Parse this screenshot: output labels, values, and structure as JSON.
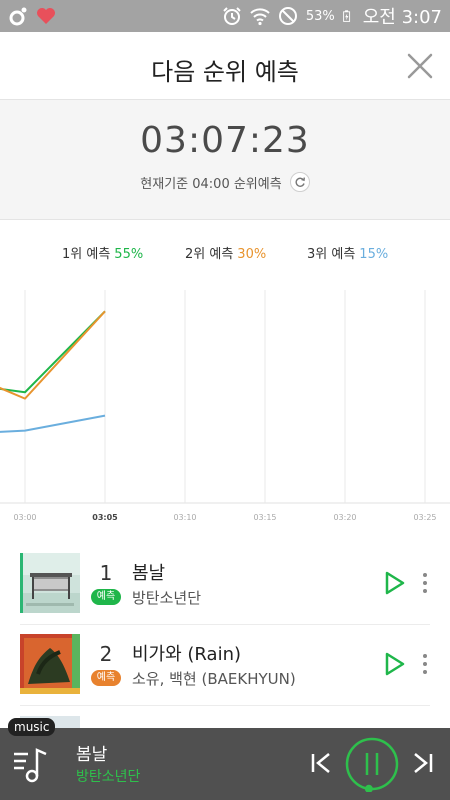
{
  "status_bar": {
    "battery": "53%",
    "time": "오전 3:07",
    "icons": [
      "app-logo-icon",
      "heart-icon",
      "alarm-icon",
      "wifi-icon",
      "block-icon",
      "battery-charging-icon"
    ]
  },
  "header": {
    "title": "다음 순위 예측",
    "close_icon": "close-icon"
  },
  "countdown": {
    "time": "03:07:23",
    "basis": "현재기준 04:00 순위예측",
    "refresh_icon": "refresh-icon"
  },
  "legend": [
    {
      "label": "1위 예측",
      "pct": "55%",
      "color": "#1fb64a"
    },
    {
      "label": "2위 예측",
      "pct": "30%",
      "color": "#e8942e"
    },
    {
      "label": "3위 예측",
      "pct": "15%",
      "color": "#6aaede"
    }
  ],
  "chart_data": {
    "type": "line",
    "x": [
      "03:00",
      "03:05",
      "03:10",
      "03:15",
      "03:20",
      "03:25"
    ],
    "series": [
      {
        "name": "1위 예측",
        "color": "#1fb64a",
        "points": [
          [
            "02:55",
            57
          ],
          [
            "03:00",
            52
          ],
          [
            "03:05",
            90
          ]
        ]
      },
      {
        "name": "2위 예측",
        "color": "#e8942e",
        "points": [
          [
            "02:55",
            65
          ],
          [
            "03:00",
            49
          ],
          [
            "03:05",
            90
          ]
        ]
      },
      {
        "name": "3위 예측",
        "color": "#6aaede",
        "points": [
          [
            "02:55",
            32
          ],
          [
            "03:00",
            34
          ],
          [
            "03:05",
            41
          ]
        ]
      }
    ],
    "ylim": [
      0,
      100
    ],
    "grid": true
  },
  "songs": [
    {
      "rank": "1",
      "badge": "예측",
      "badge_color": "#1fb64a",
      "title": "봄날",
      "artist": "방탄소년단",
      "play_icon": "play-icon",
      "more_icon": "more-vertical-icon"
    },
    {
      "rank": "2",
      "badge": "예측",
      "badge_color": "#e8822e",
      "title": "비가와 (Rain)",
      "artist": "소유, 백현 (BAEKHYUN)",
      "play_icon": "play-icon",
      "more_icon": "more-vertical-icon"
    }
  ],
  "player": {
    "tag": "music",
    "title": "봄날",
    "artist": "방탄소년단",
    "progress": 0.02,
    "icons": [
      "playlist-icon",
      "previous-icon",
      "pause-icon",
      "next-icon"
    ]
  }
}
